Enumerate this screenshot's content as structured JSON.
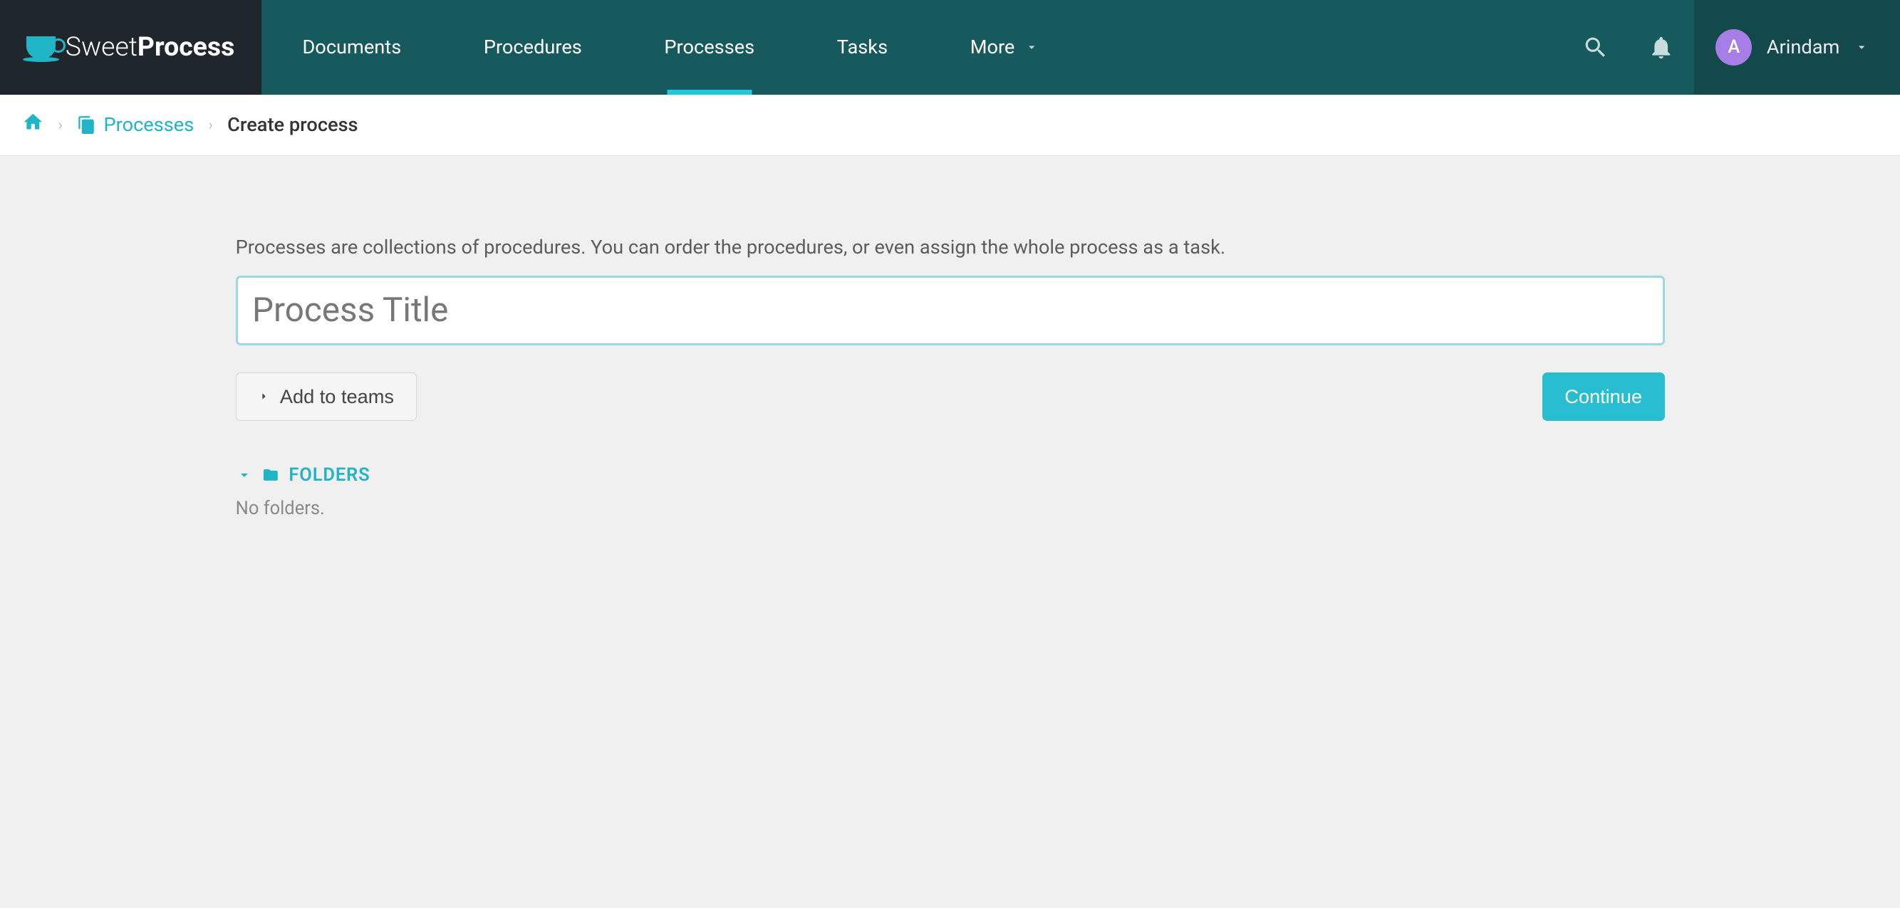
{
  "brand": {
    "name_light": "Sweet",
    "name_bold": "Process"
  },
  "nav": {
    "items": [
      {
        "label": "Documents",
        "active": false
      },
      {
        "label": "Procedures",
        "active": false
      },
      {
        "label": "Processes",
        "active": true
      },
      {
        "label": "Tasks",
        "active": false
      },
      {
        "label": "More",
        "active": false,
        "has_dropdown": true
      }
    ]
  },
  "user": {
    "initial": "A",
    "name": "Arindam"
  },
  "breadcrumb": {
    "link_label": "Processes",
    "current": "Create process"
  },
  "main": {
    "description": "Processes are collections of procedures. You can order the procedures, or even assign the whole process as a task.",
    "title_placeholder": "Process Title",
    "add_to_teams_label": "Add to teams",
    "continue_label": "Continue"
  },
  "folders": {
    "header": "FOLDERS",
    "empty_text": "No folders."
  }
}
